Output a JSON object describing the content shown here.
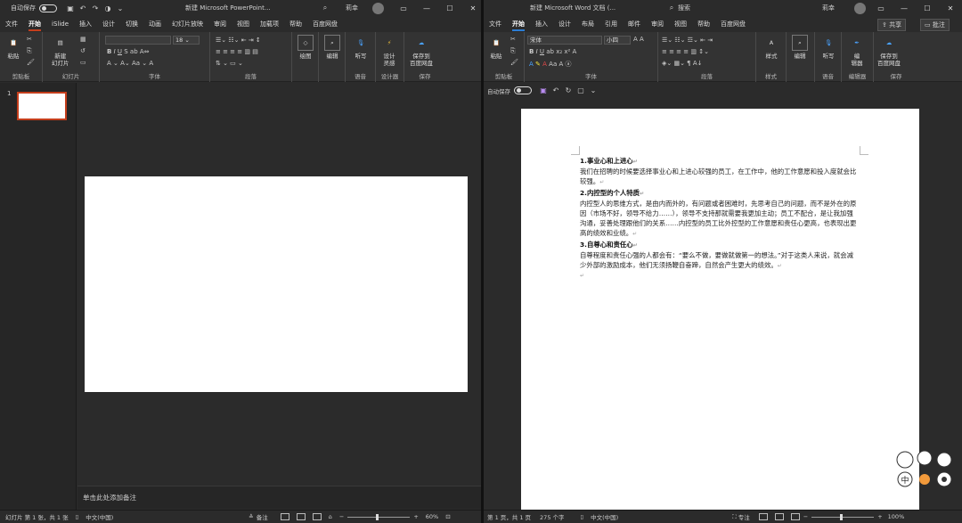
{
  "ppt": {
    "autosave_label": "自动保存",
    "title": "新建 Microsoft PowerPoint...",
    "user_name": "莉幸",
    "tabs": [
      "文件",
      "开始",
      "iSlide",
      "插入",
      "设计",
      "切换",
      "动画",
      "幻灯片放映",
      "审阅",
      "视图",
      "加载项",
      "帮助",
      "百度网盘"
    ],
    "active_tab": "开始",
    "groups": {
      "clipboard": "剪贴板",
      "slides": "幻灯片",
      "font": "字体",
      "paragraph": "段落",
      "voice": "语音",
      "designer": "设计器",
      "save": "保存"
    },
    "buttons": {
      "paste": "粘贴",
      "new_slide": "新建\n幻灯片",
      "draw": "绘图",
      "edit": "编辑",
      "dictate": "听写",
      "design_ideas": "设计\n灵感",
      "save_baidu": "保存到\n百度网盘"
    },
    "thumbnail_number": "1",
    "notes_placeholder": "单击此处添加备注",
    "status": {
      "slide_info": "幻灯片 第 1 张，共 1 张",
      "language": "中文(中国)",
      "notes": "备注",
      "zoom": "60%"
    }
  },
  "word": {
    "autosave_label": "自动保存",
    "title": "新建 Microsoft Word 文档 (...",
    "search": "搜索",
    "user_name": "莉幸",
    "share": "共享",
    "comments": "批注",
    "tabs": [
      "文件",
      "开始",
      "插入",
      "设计",
      "布局",
      "引用",
      "邮件",
      "审阅",
      "视图",
      "帮助",
      "百度网盘"
    ],
    "active_tab": "开始",
    "font_name": "宋体",
    "font_size": "小四",
    "groups": {
      "clipboard": "剪贴板",
      "font": "字体",
      "paragraph": "段落",
      "styles": "样式",
      "editing": "编辑",
      "voice": "语音",
      "editor": "编辑器",
      "save": "保存"
    },
    "buttons": {
      "paste": "粘贴",
      "styles": "样式",
      "edit": "编辑",
      "dictate": "听写",
      "editor": "编\n辑器",
      "save_baidu": "保存到\n百度网盘"
    },
    "document": [
      {
        "type": "heading",
        "text": "1.事业心和上进心"
      },
      {
        "type": "body",
        "text": "我们在招聘的时候要选择事业心和上进心较强的员工，在工作中，他的工作意愿和投入度就会比较强。"
      },
      {
        "type": "heading",
        "text": "2.内控型的个人特质"
      },
      {
        "type": "body",
        "text": "内控型人的思维方式，是由内而外的，有问题或者困难时，先思考自己的问题，而不是外在的原因（市场不好，领导不给力……），领导不支持那就需要我更加主动；员工不配合，是让我加强沟通，妥善处理跟他们的关系……内控型的员工比外控型的工作意愿和责任心更高，也表现出更高的绩效和业绩。"
      },
      {
        "type": "heading",
        "text": "3.自尊心和责任心"
      },
      {
        "type": "body",
        "text": "自尊程度和责任心强的人都会有：“要么不做，要做就做第一的想法。”对于这类人来说，就会减少外部的激励成本，他们无须扬鞭自奋蹄，自然会产生更大的绩效。"
      }
    ],
    "status": {
      "page_info": "第 1 页，共 1 页",
      "word_count": "275 个字",
      "language": "中文(中国)",
      "focus": "专注",
      "zoom": "100%"
    }
  },
  "colors": {
    "ppt_accent": "#c43e1c",
    "word_accent": "#2b7cd3",
    "ribbon_bg": "#333333",
    "window_bg": "#2b2b2b"
  }
}
